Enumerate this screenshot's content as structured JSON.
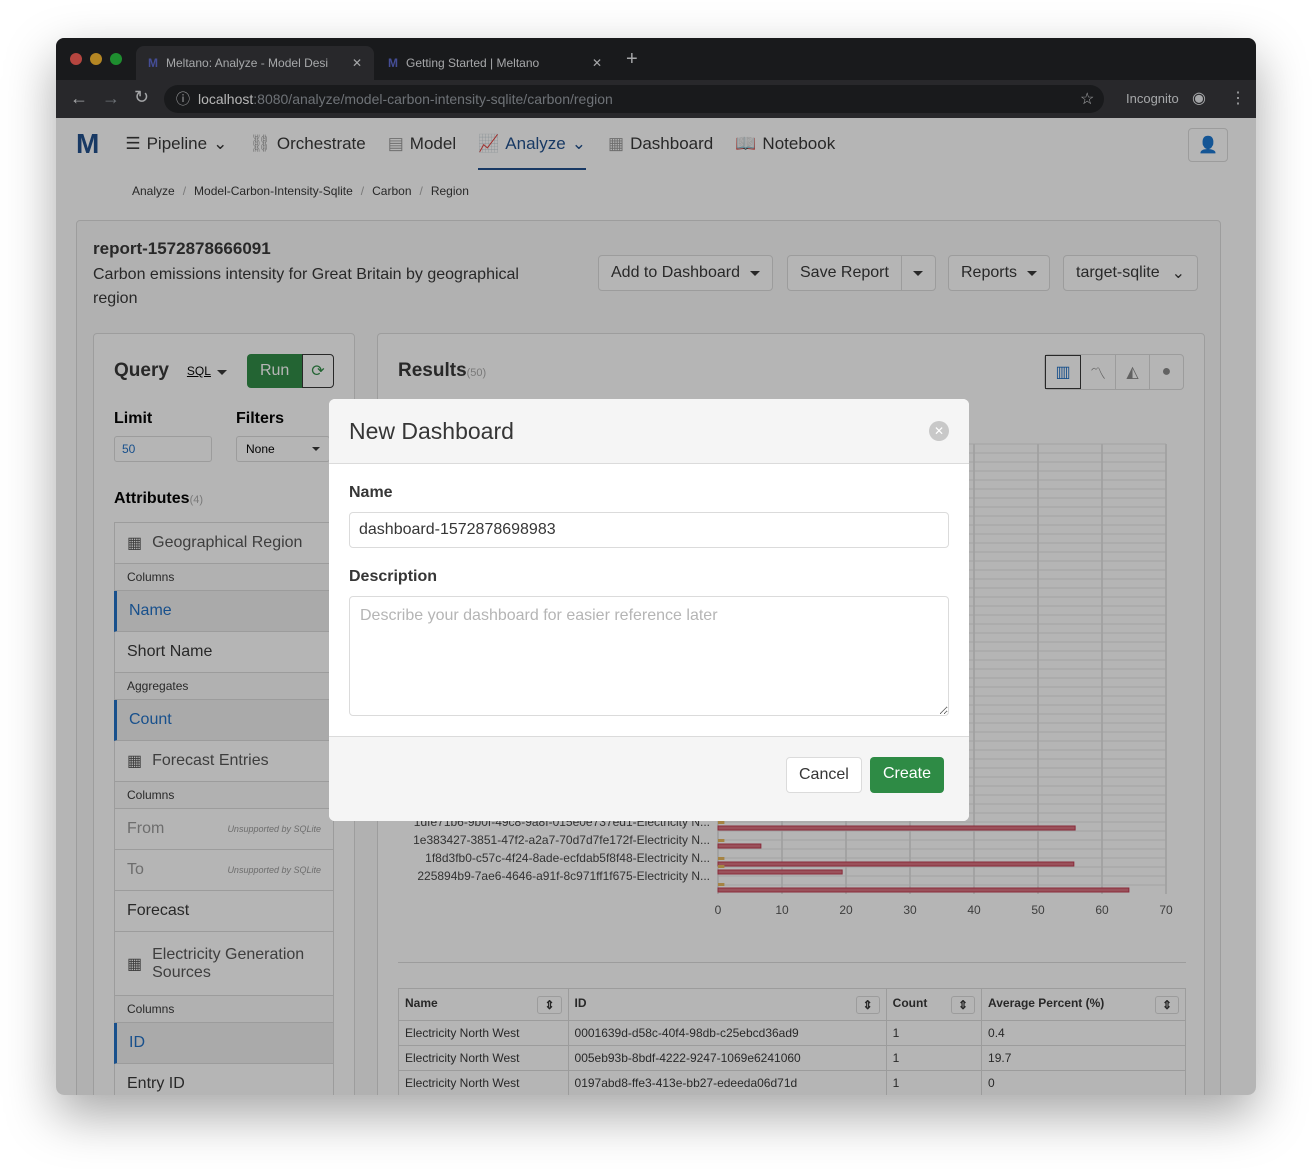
{
  "browser": {
    "tabs": [
      {
        "title": "Meltano: Analyze - Model Desi"
      },
      {
        "title": "Getting Started | Meltano"
      }
    ],
    "url_host": "localhost",
    "url_path": ":8080/analyze/model-carbon-intensity-sqlite/carbon/region",
    "profile": "Incognito"
  },
  "nav": {
    "items": [
      "Pipeline",
      "Orchestrate",
      "Model",
      "Analyze",
      "Dashboard",
      "Notebook"
    ],
    "active": "Analyze"
  },
  "breadcrumb": [
    "Analyze",
    "Model-Carbon-Intensity-Sqlite",
    "Carbon",
    "Region"
  ],
  "report": {
    "name": "report-1572878666091",
    "description": "Carbon emissions intensity for Great Britain by geographical region",
    "add_to_dashboard": "Add to Dashboard",
    "save_report": "Save Report",
    "reports": "Reports",
    "connection": "target-sqlite"
  },
  "query": {
    "title": "Query",
    "mode": "SQL",
    "run": "Run",
    "limit_label": "Limit",
    "limit": "50",
    "filters_label": "Filters",
    "filters": "None",
    "attributes_label": "Attributes",
    "attributes_count": "(4)",
    "attributes": [
      {
        "type": "table",
        "label": "Geographical Region"
      },
      {
        "type": "section",
        "label": "Columns"
      },
      {
        "type": "selected",
        "label": "Name"
      },
      {
        "type": "item",
        "label": "Short Name"
      },
      {
        "type": "section",
        "label": "Aggregates"
      },
      {
        "type": "selected",
        "label": "Count"
      },
      {
        "type": "table",
        "label": "Forecast Entries"
      },
      {
        "type": "section",
        "label": "Columns"
      },
      {
        "type": "disabled",
        "label": "From",
        "note": "Unsupported by SQLite"
      },
      {
        "type": "disabled",
        "label": "To",
        "note": "Unsupported by SQLite"
      },
      {
        "type": "item",
        "label": "Forecast"
      },
      {
        "type": "table",
        "label": "Electricity Generation Sources"
      },
      {
        "type": "section",
        "label": "Columns"
      },
      {
        "type": "selected",
        "label": "ID"
      },
      {
        "type": "item",
        "label": "Entry ID"
      }
    ]
  },
  "results": {
    "title": "Results",
    "count": "(50)",
    "chart_types": [
      "bar",
      "line",
      "area",
      "pie"
    ],
    "active_chart": "bar"
  },
  "chart_data": {
    "type": "bar",
    "orientation": "horizontal",
    "xlim": [
      0,
      70
    ],
    "xticks": [
      "0",
      "10",
      "20",
      "30",
      "40",
      "50",
      "60",
      "70"
    ],
    "grid": true,
    "categories": [
      "1dfe71b6-9b0f-49c8-9a8f-015e0e737ed1-Electricity N...",
      "1e383427-3851-47f2-a2a7-70d7d7fe172f-Electricity N...",
      "1f8d3fb0-c57c-4f24-8ade-ecfdab5f8f48-Electricity N...",
      "225894b9-7ae6-4646-a91f-8c971ff1f675-Electricity N..."
    ],
    "series": [
      {
        "color": "#d9707e",
        "values": [
          5.3,
          55.8,
          6.7,
          55.6,
          19.4,
          64.2
        ]
      },
      {
        "color": "#e8b85c",
        "values": [
          1,
          1,
          1,
          1,
          1,
          1
        ]
      }
    ]
  },
  "table": {
    "columns": [
      "Name",
      "ID",
      "Count",
      "Average Percent (%)"
    ],
    "rows": [
      [
        "Electricity North West",
        "0001639d-d58c-40f4-98db-c25ebcd36ad9",
        "1",
        "0.4"
      ],
      [
        "Electricity North West",
        "005eb93b-8bdf-4222-9247-1069e6241060",
        "1",
        "19.7"
      ],
      [
        "Electricity North West",
        "0197abd8-ffe3-413e-bb27-edeeda06d71d",
        "1",
        "0"
      ]
    ]
  },
  "modal": {
    "title": "New Dashboard",
    "name_label": "Name",
    "name_value": "dashboard-1572878698983",
    "description_label": "Description",
    "description_placeholder": "Describe your dashboard for easier reference later",
    "cancel": "Cancel",
    "create": "Create"
  }
}
